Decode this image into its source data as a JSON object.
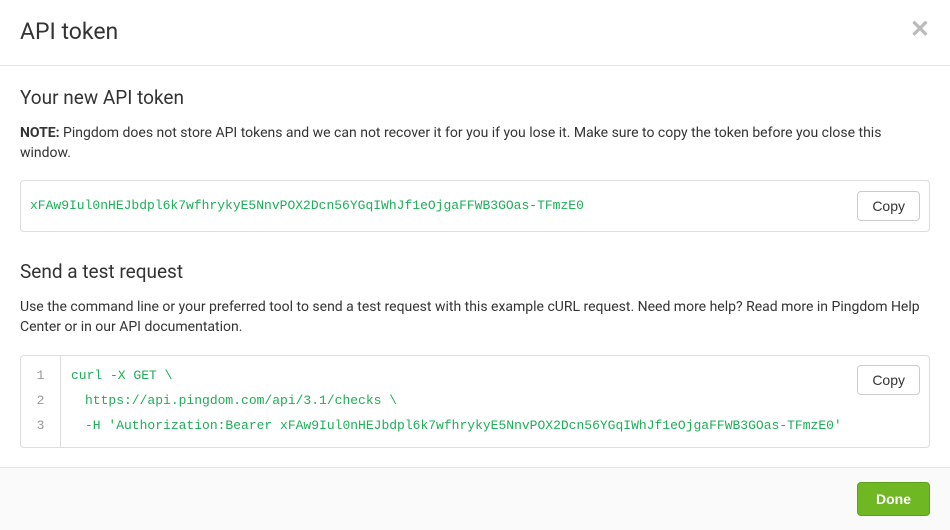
{
  "header": {
    "title": "API token"
  },
  "section_token": {
    "title": "Your new API token",
    "note_label": "NOTE:",
    "note_text": " Pingdom does not store API tokens and we can not recover it for you if you lose it. Make sure to copy the token before you close this window.",
    "token_value": "xFAw9Iul0nHEJbdpl6k7wfhrykyE5NnvPOX2Dcn56YGqIWhJf1eOjgaFFWB3GOas-TFmzE0",
    "copy_label": "Copy"
  },
  "section_test": {
    "title": "Send a test request",
    "help_text": "Use the command line or your preferred tool to send a test request with this example cURL request. Need more help? Read more in Pingdom Help Center or in our API documentation.",
    "line_numbers": {
      "l1": "1",
      "l2": "2",
      "l3": "3"
    },
    "code": {
      "line1": "curl -X GET \\",
      "line2": "https://api.pingdom.com/api/3.1/checks \\",
      "line3": "-H 'Authorization:Bearer xFAw9Iul0nHEJbdpl6k7wfhrykyE5NnvPOX2Dcn56YGqIWhJf1eOjgaFFWB3GOas-TFmzE0'"
    },
    "copy_label": "Copy"
  },
  "footer": {
    "done_label": "Done"
  }
}
